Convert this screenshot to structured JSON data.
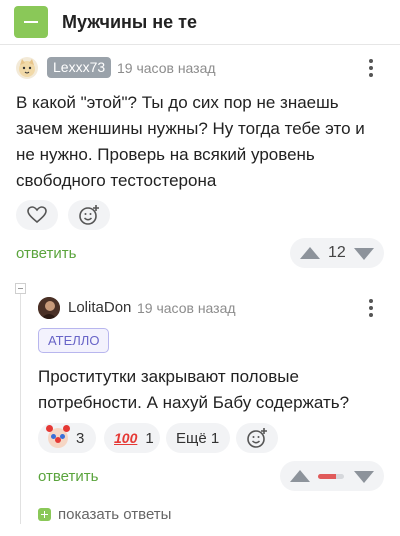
{
  "header": {
    "title": "Мужчины не те",
    "accent": "#8ac858"
  },
  "comment1": {
    "username": "Lexxx73",
    "time": "19 часов назад",
    "text": "В какой \"этой\"? Ты до сих пор не знаешь зачем женшины нужны? Ну тогда тебе это и не нужно. Проверь на всякий уровень свободного тестостерона",
    "reply_label": "ответить",
    "rating": "12"
  },
  "comment2": {
    "username": "LolitaDon",
    "time": "19 часов назад",
    "tag": "АТЕЛЛО",
    "text": "Проститутки закрывают половые потребности. А нахуй Бабу содержать?",
    "reactions": [
      {
        "icon": "clown-face-icon",
        "count": "3"
      },
      {
        "icon": "hundred-points-icon",
        "count": "1"
      }
    ],
    "more_reactions": "Ещё 1",
    "reply_label": "ответить",
    "rating_indicator_color": "#e05a5a"
  },
  "show_replies_label": "показать ответы",
  "colors": {
    "link": "#5aa43c",
    "tag_text": "#6864c7",
    "tag_border": "#b8b6ee",
    "badge_bg": "#9aa2aa"
  }
}
